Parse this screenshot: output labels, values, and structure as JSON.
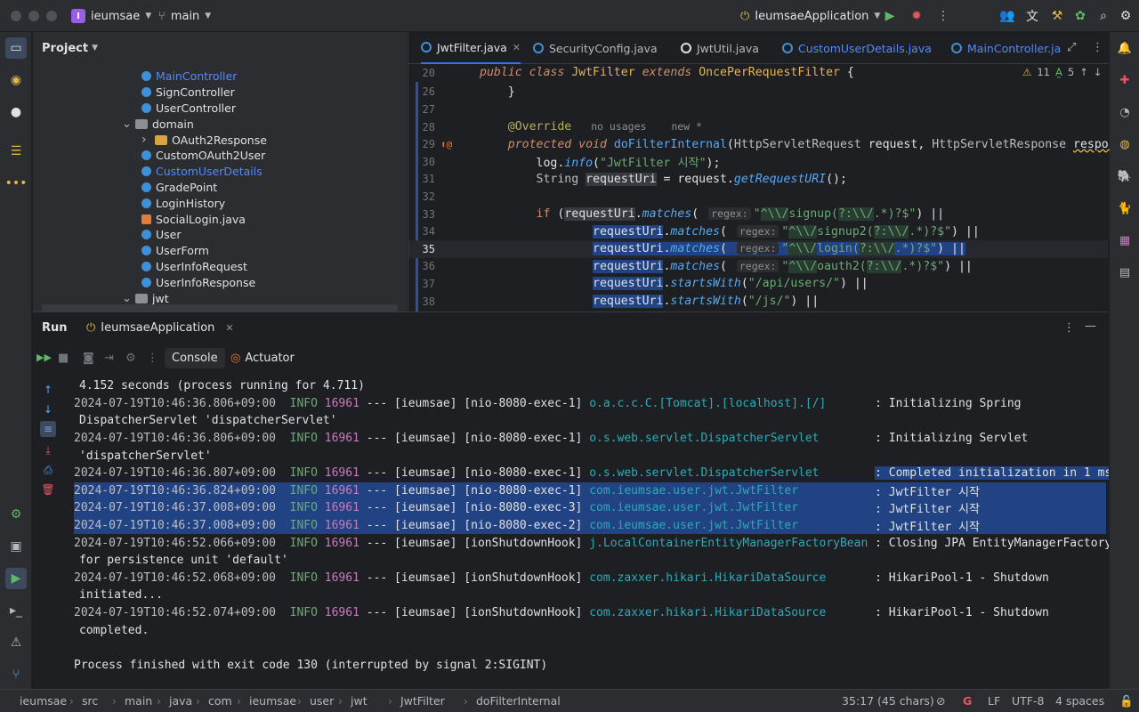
{
  "titlebar": {
    "project_badge": "I",
    "project_name": "ieumsae",
    "branch": "main",
    "run_config": "IeumsaeApplication"
  },
  "project_panel": {
    "title": "Project",
    "items": [
      {
        "label": "MainController",
        "type": "class",
        "indent": 2
      },
      {
        "label": "SignController",
        "type": "class",
        "indent": 2
      },
      {
        "label": "UserController",
        "type": "class",
        "indent": 2
      },
      {
        "label": "domain",
        "type": "package",
        "indent": 1,
        "expanded": true
      },
      {
        "label": "OAuth2Response",
        "type": "folder",
        "indent": 2,
        "expanded": false
      },
      {
        "label": "CustomOAuth2User",
        "type": "class",
        "indent": 2
      },
      {
        "label": "CustomUserDetails",
        "type": "class",
        "indent": 2
      },
      {
        "label": "GradePoint",
        "type": "class",
        "indent": 2
      },
      {
        "label": "LoginHistory",
        "type": "class",
        "indent": 2
      },
      {
        "label": "SocialLogin.java",
        "type": "java",
        "indent": 2
      },
      {
        "label": "User",
        "type": "class",
        "indent": 2
      },
      {
        "label": "UserForm",
        "type": "class",
        "indent": 2
      },
      {
        "label": "UserInfoRequest",
        "type": "class",
        "indent": 2
      },
      {
        "label": "UserInfoResponse",
        "type": "class",
        "indent": 2
      },
      {
        "label": "jwt",
        "type": "package",
        "indent": 1,
        "expanded": true
      }
    ]
  },
  "editor": {
    "tabs": [
      "JwtFilter.java",
      "SecurityConfig.java",
      "JwtUtil.java",
      "CustomUserDetails.java",
      "MainController.ja"
    ],
    "warnings": "11",
    "typos": "5",
    "lines": [
      {
        "n": "20"
      },
      {
        "n": "26"
      },
      {
        "n": "27"
      },
      {
        "n": "28"
      },
      {
        "n": "29"
      },
      {
        "n": "30"
      },
      {
        "n": "31"
      },
      {
        "n": "32"
      },
      {
        "n": "33"
      },
      {
        "n": "34"
      },
      {
        "n": "35"
      },
      {
        "n": "36"
      },
      {
        "n": "37"
      },
      {
        "n": "38"
      }
    ],
    "hints": {
      "usages": "no usages",
      "new": "new *",
      "regex": "regex:"
    }
  },
  "run_panel": {
    "title": "Run",
    "config_tab": "IeumsaeApplication",
    "tabs": [
      "Console",
      "Actuator"
    ],
    "console": [
      {
        "text": "4.152 seconds (process running for 4.711)"
      },
      {
        "date": "2024-07-19T10:46:36.806+09:00",
        "level": "INFO",
        "pid": "16961",
        "mid": "--- [ieumsae] [nio-8080-exec-1]",
        "logger": "o.a.c.c.C.[Tomcat].[localhost].[/]      ",
        "msg": ": Initializing Spring"
      },
      {
        "text": "DispatcherServlet 'dispatcherServlet'"
      },
      {
        "date": "2024-07-19T10:46:36.806+09:00",
        "level": "INFO",
        "pid": "16961",
        "mid": "--- [ieumsae] [nio-8080-exec-1]",
        "logger": "o.s.web.servlet.DispatcherServlet       ",
        "msg": ": Initializing Servlet"
      },
      {
        "text": "'dispatcherServlet'"
      },
      {
        "date": "2024-07-19T10:46:36.807+09:00",
        "level": "INFO",
        "pid": "16961",
        "mid": "--- [ieumsae] [nio-8080-exec-1]",
        "logger": "o.s.web.servlet.DispatcherServlet       ",
        "msg": ": Completed initialization in 1 ms"
      },
      {
        "date": "2024-07-19T10:46:36.824+09:00",
        "level": "INFO",
        "pid": "16961",
        "mid": "--- [ieumsae] [nio-8080-exec-1]",
        "logger": "com.ieumsae.user.jwt.JwtFilter          ",
        "msg": ": JwtFilter 시작"
      },
      {
        "date": "2024-07-19T10:46:37.008+09:00",
        "level": "INFO",
        "pid": "16961",
        "mid": "--- [ieumsae] [nio-8080-exec-3]",
        "logger": "com.ieumsae.user.jwt.JwtFilter          ",
        "msg": ": JwtFilter 시작"
      },
      {
        "date": "2024-07-19T10:46:37.008+09:00",
        "level": "INFO",
        "pid": "16961",
        "mid": "--- [ieumsae] [nio-8080-exec-2]",
        "logger": "com.ieumsae.user.jwt.JwtFilter          ",
        "msg": ": JwtFilter 시작"
      },
      {
        "date": "2024-07-19T10:46:52.066+09:00",
        "level": "INFO",
        "pid": "16961",
        "mid": "--- [ieumsae] [ionShutdownHook]",
        "logger": "j.LocalContainerEntityManagerFactoryBean",
        "msg": ": Closing JPA EntityManagerFactory"
      },
      {
        "text": "for persistence unit 'default'"
      },
      {
        "date": "2024-07-19T10:46:52.068+09:00",
        "level": "INFO",
        "pid": "16961",
        "mid": "--- [ieumsae] [ionShutdownHook]",
        "logger": "com.zaxxer.hikari.HikariDataSource      ",
        "msg": ": HikariPool-1 - Shutdown"
      },
      {
        "text": "initiated..."
      },
      {
        "date": "2024-07-19T10:46:52.074+09:00",
        "level": "INFO",
        "pid": "16961",
        "mid": "--- [ieumsae] [ionShutdownHook]",
        "logger": "com.zaxxer.hikari.HikariDataSource      ",
        "msg": ": HikariPool-1 - Shutdown"
      },
      {
        "text": "completed."
      },
      {
        "text": ""
      },
      {
        "text": "Process finished with exit code 130 (interrupted by signal 2:SIGINT)"
      }
    ]
  },
  "statusbar": {
    "breadcrumbs": [
      "ieumsae",
      "src",
      "main",
      "java",
      "com",
      "ieumsae",
      "user",
      "jwt",
      "JwtFilter",
      "doFilterInternal"
    ],
    "position": "35:17 (45 chars)",
    "line_sep": "LF",
    "encoding": "UTF-8",
    "indent": "4 spaces"
  }
}
